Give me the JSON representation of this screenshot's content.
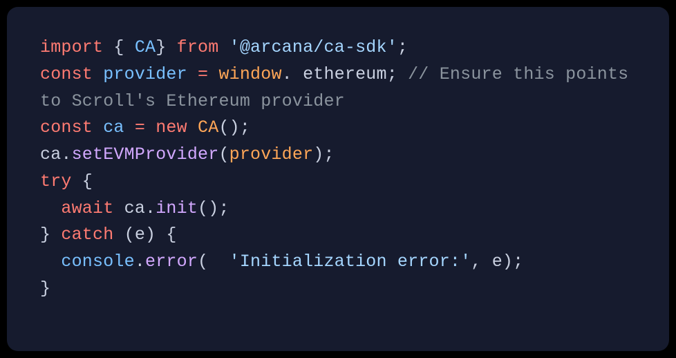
{
  "code": {
    "line1": {
      "import": "import",
      "brace_open": " { ",
      "class_name": "CA",
      "brace_close": "} ",
      "from": "from",
      "space": " ",
      "string": "'@arcana/ca-sdk'",
      "semi": ";"
    },
    "line2": {
      "const": "const",
      "var": " provider ",
      "eq": "=",
      "window": " window",
      "dot": ".",
      "ethereum": " ethereum",
      "semi": "; ",
      "comment": "// Ensure this points to Scroll's Ethereum provider"
    },
    "line3": {
      "const": "const",
      "var": " ca ",
      "eq": "=",
      "new": " new",
      "class": " CA",
      "parens": "();"
    },
    "line4": {
      "obj": "ca",
      "dot": ".",
      "method": "setEVMProvider",
      "open": "(",
      "arg": "provider",
      "close": ");"
    },
    "line5": {
      "try": "try",
      "brace": " {"
    },
    "line6": {
      "indent": "  ",
      "await": "await",
      "obj": " ca",
      "dot": ".",
      "method": "init",
      "parens": "();"
    },
    "line7": {
      "close": "} ",
      "catch": "catch",
      "open": " (",
      "e": "e",
      "close2": ") {"
    },
    "line8": {
      "indent": "  ",
      "console": "console",
      "dot": ".",
      "error": "error",
      "open": "( ",
      "string": " 'Initialization error:'",
      "comma": ", ",
      "e": "e",
      "close": ");"
    },
    "line9": {
      "close": "}"
    }
  }
}
